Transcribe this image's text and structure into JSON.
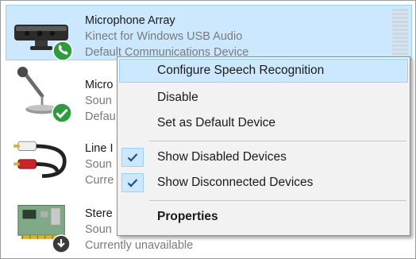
{
  "devices": [
    {
      "name": "Microphone Array",
      "line2": "Kinect for Windows USB Audio",
      "line3": "Default Communications Device",
      "icon": "kinect-sensor-icon",
      "badge": "phone-badge-icon"
    },
    {
      "name": "Micro",
      "line2": "Soun",
      "line3": "Defau",
      "icon": "microphone-icon",
      "badge": "checkmark-badge-icon"
    },
    {
      "name": "Line I",
      "line2": "Soun",
      "line3": "Curre",
      "icon": "rca-cable-icon"
    },
    {
      "name": "Stere",
      "line2": "Soun",
      "line3": "Currently unavailable",
      "icon": "sound-card-icon",
      "badge": "down-arrow-badge-icon"
    }
  ],
  "context_menu": {
    "configure": "Configure Speech Recognition",
    "disable": "Disable",
    "set_default": "Set as Default Device",
    "show_disabled": "Show Disabled Devices",
    "show_disconnected": "Show Disconnected Devices",
    "properties": "Properties"
  },
  "colors": {
    "selection": "#cce8ff",
    "selection_border": "#99d1ff",
    "check": "#1e4f8f"
  }
}
